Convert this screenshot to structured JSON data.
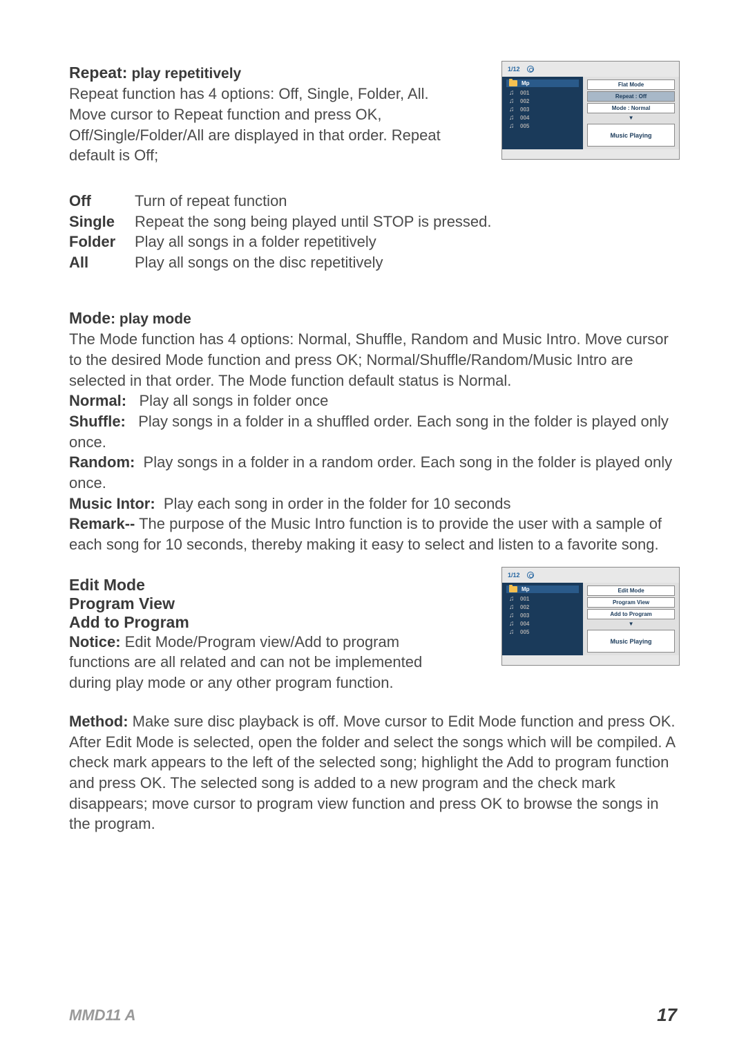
{
  "repeat": {
    "heading": "Repeat:",
    "subheading": "play repetitively",
    "body": "Repeat function has 4 options: Off, Single, Folder, All. Move cursor to Repeat function and press OK, Off/Single/Folder/All are displayed in that order. Repeat default is Off;",
    "options": [
      {
        "label": "Off",
        "desc": "Turn of repeat function"
      },
      {
        "label": "Single",
        "desc": "Repeat the song being played until STOP is pressed."
      },
      {
        "label": "Folder",
        "desc": "Play all songs in a folder repetitively"
      },
      {
        "label": "All",
        "desc": "Play all songs on the disc repetitively"
      }
    ]
  },
  "mode": {
    "heading": "Mode",
    "subheading": ": play mode",
    "body": "The Mode function has 4 options: Normal, Shuffle, Random and Music Intro. Move cursor to the desired Mode function and press OK; Normal/Shuffle/Random/Music Intro are selected in that order. The Mode function default status is Normal.",
    "normal_label": "Normal:",
    "normal_desc": "   Play all songs in folder once",
    "shuffle_label": "Shuffle:",
    "shuffle_desc": "   Play songs in a folder in a shuffled order. Each song in the folder is played only once.",
    "random_label": "Random:",
    "random_desc": "  Play songs in a folder in a random order. Each song in the folder is played only once.",
    "intro_label": "Music Intor:",
    "intro_desc": "  Play each song in order in the folder for 10 seconds",
    "remark_label": "Remark--",
    "remark_desc": " The purpose of the Music Intro function is to provide the user with a sample of each song for 10 seconds, thereby making it easy to select and listen to a favorite song."
  },
  "edit": {
    "h1": "Edit Mode",
    "h2": "Program View",
    "h3": "Add to Program",
    "notice_label": "Notice:",
    "notice_desc": " Edit Mode/Program view/Add to program functions are all related and can not be implemented during play mode or any other program function.",
    "method_label": "Method:",
    "method_desc": " Make sure disc playback is off. Move cursor to Edit Mode function and press OK. After Edit Mode is selected, open the folder and select the songs which will be compiled. A check mark appears to the left of the selected song; highlight the Add to program function and press OK. The selected song is added to a new program and the check mark disappears; move cursor to program view function and press OK to browse the songs in the program."
  },
  "figure1": {
    "counter": "1/12",
    "folder": "Mp",
    "tracks": [
      "001",
      "002",
      "003",
      "004",
      "005"
    ],
    "menu1": "Flat  Mode",
    "menu2": "Repeat :    Off",
    "menu3": "Mode    :    Normal",
    "playbox": "Music Playing"
  },
  "figure2": {
    "counter": "1/12",
    "folder": "Mp",
    "tracks": [
      "001",
      "002",
      "003",
      "004",
      "005"
    ],
    "menu1": "Edit  Mode",
    "menu2": "Program View",
    "menu3": "Add to Program",
    "playbox": "Music Playing"
  },
  "footer": {
    "model": "MMD11 A",
    "page": "17"
  }
}
